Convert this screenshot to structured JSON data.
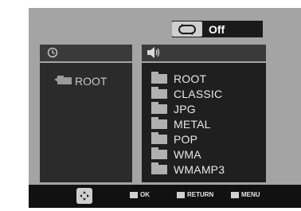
{
  "repeat": {
    "icon": "repeat-icon",
    "label": "Off"
  },
  "left_panel": {
    "header_icon": "clock-icon",
    "root_label": "ROOT",
    "root_icon": "folder-up-icon"
  },
  "right_panel": {
    "header_icon": "speaker-icon",
    "items": [
      {
        "label": "ROOT",
        "icon": "folder-icon"
      },
      {
        "label": "CLASSIC",
        "icon": "folder-icon"
      },
      {
        "label": "JPG",
        "icon": "folder-icon"
      },
      {
        "label": "METAL",
        "icon": "folder-icon"
      },
      {
        "label": "POP",
        "icon": "folder-icon"
      },
      {
        "label": "WMA",
        "icon": "folder-icon"
      },
      {
        "label": "WMAMP3",
        "icon": "folder-icon"
      }
    ]
  },
  "footer": {
    "nav_icon": "navigation-pad-icon",
    "ok_label": "OK",
    "return_label": "RETURN",
    "menu_label": "MENU"
  }
}
